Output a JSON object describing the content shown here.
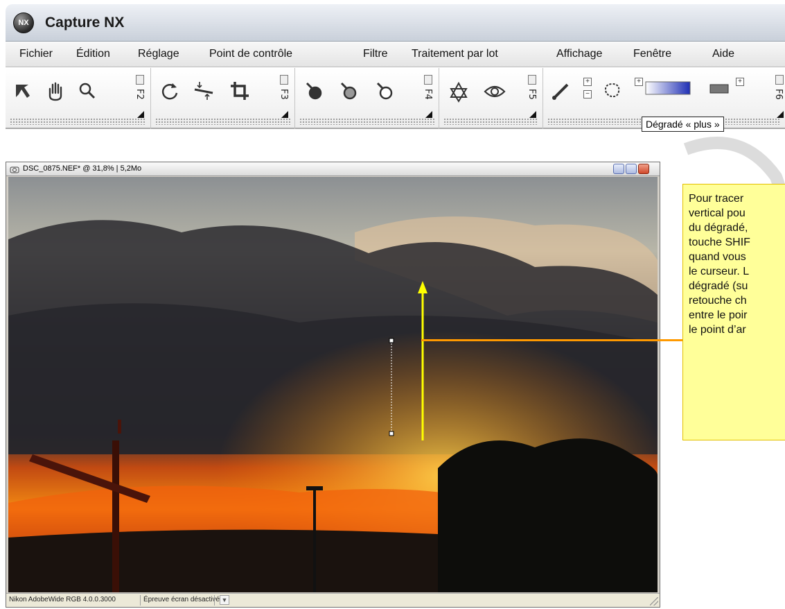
{
  "app": {
    "title": "Capture NX",
    "logo_text": "NX"
  },
  "menu": [
    {
      "label": "Fichier"
    },
    {
      "label": "Édition"
    },
    {
      "label": "Réglage"
    },
    {
      "label": "Point de contrôle"
    },
    {
      "label": "Filtre"
    },
    {
      "label": "Traitement par lot"
    },
    {
      "label": "Affichage"
    },
    {
      "label": "Fenêtre"
    },
    {
      "label": "Aide"
    }
  ],
  "toolbar": {
    "groups": [
      {
        "shortcut": "F2",
        "tools": [
          "direct-select-tool",
          "hand-tool",
          "zoom-tool"
        ]
      },
      {
        "shortcut": "F3",
        "tools": [
          "rotate-tool",
          "straighten-tool",
          "crop-tool"
        ]
      },
      {
        "shortcut": "F4",
        "tools": [
          "black-point-tool",
          "neutral-point-tool",
          "white-point-tool"
        ]
      },
      {
        "shortcut": "F5",
        "tools": [
          "red-eye-tool",
          "auto-retouch-tool"
        ]
      },
      {
        "shortcut": "F6",
        "tools": [
          "brush-tool",
          "lasso-tool",
          "gradient-plus-tool",
          "fill-tool"
        ]
      }
    ],
    "plus": "+",
    "minus": "−"
  },
  "tooltip": {
    "text": "Dégradé « plus »"
  },
  "image_window": {
    "title": "DSC_0875.NEF* @ 31,8% | 5,2Mo",
    "status": {
      "profile": "Nikon AdobeWide RGB 4.0.0.3000",
      "proof": "Épreuve écran désactivée"
    }
  },
  "callout": {
    "lines": [
      "Pour tracer",
      "vertical pou",
      "du dégradé,",
      "touche SHIF",
      "quand vous",
      "le curseur. L",
      "dégradé (su",
      "retouche ch",
      "entre le poir",
      "le point d’ar"
    ]
  },
  "colors": {
    "arrow": "#ffff00",
    "callout_line": "#ff9900",
    "callout_bg": "#ffff99"
  }
}
